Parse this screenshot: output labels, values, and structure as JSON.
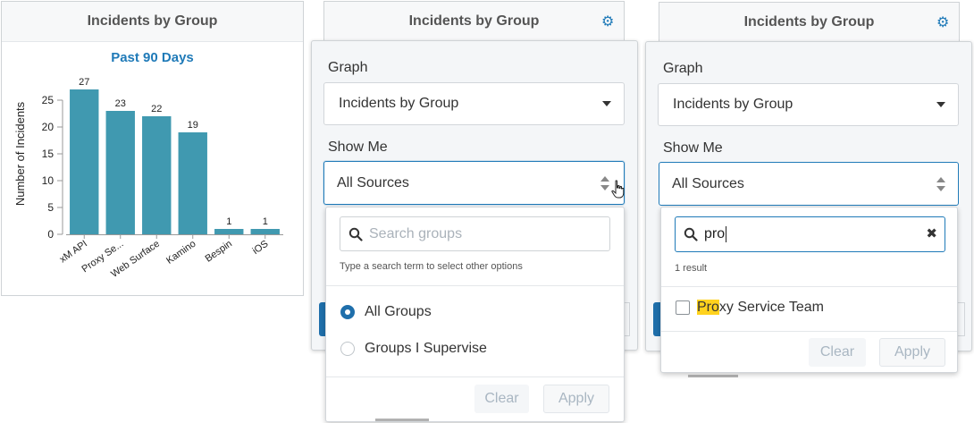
{
  "panel1": {
    "header": "Incidents by Group",
    "chart_data": {
      "type": "bar",
      "title": "Past 90 Days",
      "ylabel": "Number of Incidents",
      "xlabel": "",
      "ylim": [
        0,
        30
      ],
      "yticks": [
        0,
        5,
        10,
        15,
        20,
        25
      ],
      "categories": [
        "xM API",
        "Proxy Se...",
        "Web Surface",
        "Kamino",
        "Bespin",
        "iOS"
      ],
      "values": [
        27,
        23,
        22,
        19,
        1,
        1
      ],
      "bar_color": "#4099b0",
      "grid": false
    }
  },
  "panel2": {
    "header": "Incidents by Group",
    "gear_icon": "gear-icon",
    "graph_label": "Graph",
    "graph_value": "Incidents by Group",
    "show_me_label": "Show Me",
    "show_me_value": "All Sources",
    "search_placeholder": "Search groups",
    "hint": "Type a search term to select other options",
    "options": [
      {
        "label": "All Groups",
        "selected": true
      },
      {
        "label": "Groups I Supervise",
        "selected": false
      }
    ],
    "clear": "Clear",
    "apply": "Apply"
  },
  "panel3": {
    "header": "Incidents by Group",
    "gear_icon": "gear-icon",
    "graph_label": "Graph",
    "graph_value": "Incidents by Group",
    "show_me_label": "Show Me",
    "show_me_value": "All Sources",
    "search_value": "pro",
    "result_count": "1 result",
    "result_match": "Pro",
    "result_rest": "xy Service Team",
    "clear": "Clear",
    "apply": "Apply"
  },
  "colors": {
    "accent": "#1f7ab8",
    "bar": "#4099b0",
    "highlight": "#ffd21e"
  }
}
